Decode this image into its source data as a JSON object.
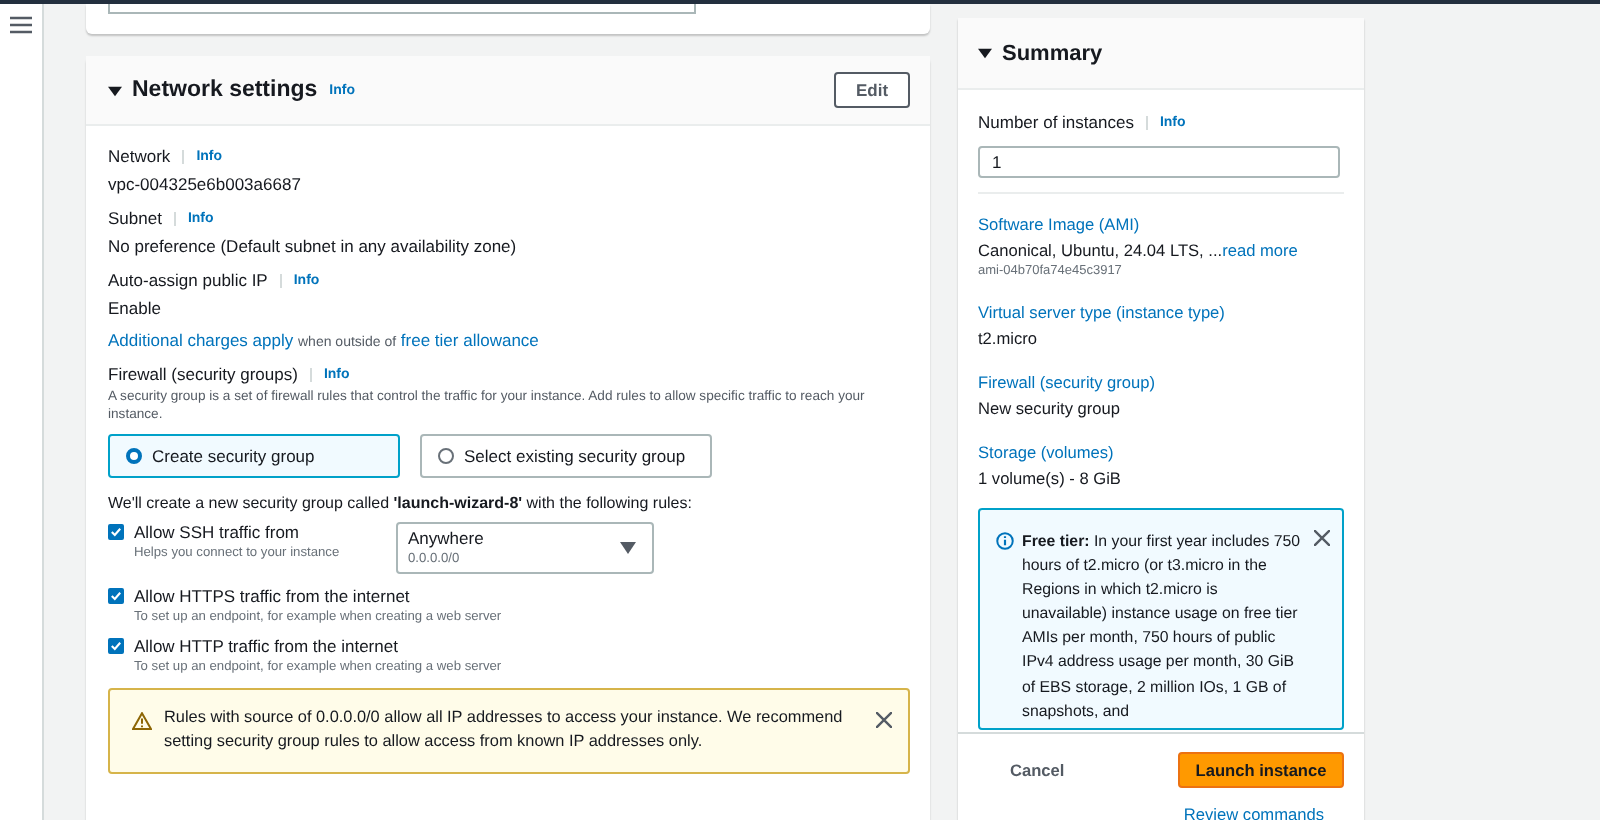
{
  "network_settings": {
    "title": "Network settings",
    "info": "Info",
    "expanded": true,
    "edit_button": "Edit",
    "fields": [
      {
        "label": "Network",
        "info": "Info",
        "value": "vpc-004325e6b003a6687"
      },
      {
        "label": "Subnet",
        "info": "Info",
        "value": "No preference (Default subnet in any availability zone)"
      },
      {
        "label": "Auto-assign public IP",
        "info": "Info",
        "value": "Enable"
      }
    ],
    "charges_note": {
      "link": "Additional charges apply",
      "text": "when outside of",
      "link2": "free tier allowance"
    },
    "firewall": {
      "label": "Firewall (security groups)",
      "info": "Info",
      "description": "A security group is a set of firewall rules that control the traffic for your instance. Add rules to allow specific traffic to reach your instance.",
      "options": [
        {
          "label": "Create security group",
          "selected": true
        },
        {
          "label": "Select existing security group",
          "selected": false
        }
      ],
      "rules_intro": "We'll create a new security group called **'launch-wizard-8'** with the following rules:",
      "rules": [
        {
          "label": "Allow SSH traffic from",
          "hint": "Helps you connect to your instance",
          "checked": true,
          "source": {
            "value": "Anywhere",
            "hint": "0.0.0.0/0"
          }
        },
        {
          "label": "Allow HTTPS traffic from the internet",
          "hint": "To set up an endpoint, for example when creating a web server",
          "checked": true
        },
        {
          "label": "Allow HTTP traffic from the internet",
          "hint": "To set up an endpoint, for example when creating a web server",
          "checked": true
        }
      ],
      "warning": "Rules with source of 0.0.0.0/0 allow all IP addresses to access your instance. We recommend setting security group rules to allow access from known IP addresses only."
    }
  },
  "summary": {
    "title": "Summary",
    "expanded": true,
    "instances_label": "Number of instances",
    "info": "Info",
    "instances_value": "1",
    "items": [
      {
        "title": "Software Image (AMI)",
        "value": "Canonical, Ubuntu, 24.04 LTS, ...",
        "read_more": "read more",
        "detail": "ami-04b70fa74e45c3917"
      },
      {
        "title": "Virtual server type (instance type)",
        "value": "t2.micro"
      },
      {
        "title": "Firewall (security group)",
        "value": "New security group"
      },
      {
        "title": "Storage (volumes)",
        "value": "1 volume(s) - 8 GiB"
      }
    ],
    "free_tier": "**Free tier:** In your first year includes 750 hours of t2.micro (or t3.micro in the Regions in which t2.micro is unavailable) instance usage on free tier AMIs per month, 750 hours of public IPv4 address usage per month, 30 GiB of EBS storage, 2 million IOs, 1 GB of snapshots, and",
    "cancel": "Cancel",
    "launch": "Launch instance",
    "review": "Review commands"
  }
}
